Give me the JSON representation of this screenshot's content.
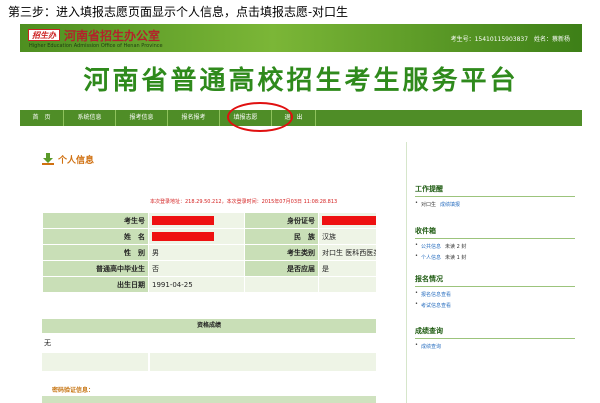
{
  "caption": "第三步：进入填报志愿页面显示个人信息，点击填报志愿-对口生",
  "header": {
    "logo_badge": "招生办",
    "logo_title": "河南省招生办公室",
    "logo_sub": "Higher Education Admission Office of Henan Province",
    "user_label": "考生号：15410115903837",
    "name_label": "姓名：蔡新杨",
    "banner": "河南省普通高校招生考生服务平台"
  },
  "nav": [
    "首　页",
    "系统信息",
    "报考信息",
    "报名报考",
    "填报志愿",
    "退　出"
  ],
  "main": {
    "title": "个人信息",
    "ip_line": "本次登录地址：218.29.50.212，本次登录时间：2015年07月03日 11:08:28.813",
    "rows": [
      {
        "l1": "考生号",
        "v1": "",
        "l2": "身份证号",
        "v2": ""
      },
      {
        "l1": "姓　名",
        "v1": "",
        "l2": "民　族",
        "v2": "汉族"
      },
      {
        "l1": "性　别",
        "v1": "男",
        "l2": "考生类别",
        "v2": "对口生 医科西医类"
      },
      {
        "l1": "普通高中毕业生",
        "v1": "否",
        "l2": "是否应届",
        "v2": "是"
      },
      {
        "l1": "出生日期",
        "v1": "1991-04-25",
        "l2": "",
        "v2": ""
      }
    ],
    "score_head": "资格成绩",
    "score_value": "无",
    "verify": "密码验证信息："
  },
  "side": {
    "sec1_title": "工作提醒",
    "sec1_items": [
      {
        "k": "对口生",
        "v": "成绩填报"
      }
    ],
    "sec2_title": "收件箱",
    "sec2_items": [
      {
        "k": "公共信息",
        "v": "未读 2 封"
      },
      {
        "k": "个人信息",
        "v": "未读 1 封"
      }
    ],
    "sec3_title": "报名情况",
    "sec3_items": [
      "报名信息查看",
      "考试信息查看"
    ],
    "sec4_title": "成绩查询",
    "sec4_items": [
      "成绩查询"
    ]
  },
  "colors": {
    "nav": "#4f8d27",
    "banner": "#2f8a1c",
    "highlight": "#e01010",
    "redact": "#ee1111"
  }
}
